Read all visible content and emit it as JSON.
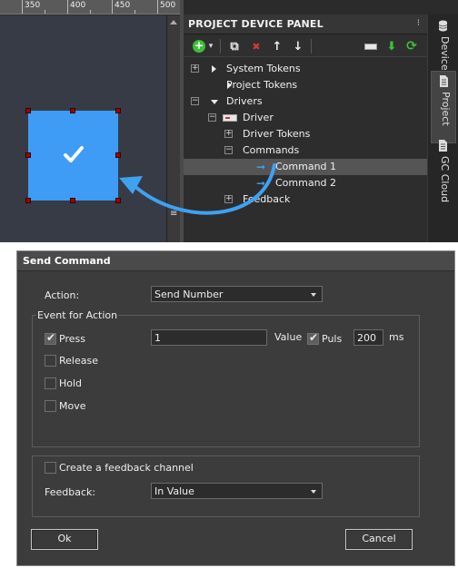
{
  "ruler": {
    "ticks": [
      "350",
      "400",
      "450",
      "500"
    ]
  },
  "widget": {
    "icon": "checkmark-icon",
    "fill": "#3e9cf6",
    "handle_color": "#a30000"
  },
  "panel": {
    "title": "PROJECT DEVICE PANEL",
    "pin_glyph": "⁝",
    "toolbar": {
      "add_glyph": "+",
      "dropdown_glyph": "▾",
      "copy_glyph": "⧉",
      "delete_glyph": "✖",
      "up_glyph": "↑",
      "down_glyph": "↓",
      "import_glyph": "⬇",
      "refresh_glyph": "⟳"
    },
    "tree": [
      {
        "label": "System Tokens"
      },
      {
        "label": "Project Tokens"
      },
      {
        "label": "Drivers"
      },
      {
        "label": "Driver"
      },
      {
        "label": "Driver Tokens"
      },
      {
        "label": "Commands"
      },
      {
        "label": "Command 1",
        "selected": true
      },
      {
        "label": "Command 2"
      },
      {
        "label": "Feedback"
      }
    ],
    "expander_plus": "+",
    "expander_minus": "−",
    "cmd_arrow": "➞"
  },
  "side_tabs": [
    "Device",
    "Project",
    "GC Cloud"
  ],
  "colors": {
    "accent": "#3ea2f2",
    "add_green": "#3cbf3c",
    "delete_red": "#d23a3a",
    "import_green": "#3cbf3c"
  },
  "dialog": {
    "title": "Send Command",
    "action_label": "Action:",
    "action_value": "Send Number",
    "event_group_label": "Event for Action",
    "events": [
      {
        "label": "Press",
        "checked": true
      },
      {
        "label": "Release",
        "checked": false
      },
      {
        "label": "Hold",
        "checked": false
      },
      {
        "label": "Move",
        "checked": false
      }
    ],
    "check_glyph": "✔",
    "value_input": "1",
    "value_label": "Value",
    "puls_label": "Puls",
    "puls_checked": true,
    "ms_input": "200",
    "ms_label": "ms",
    "feedback_channel_label": "Create a feedback channel",
    "feedback_label": "Feedback:",
    "feedback_value": "In Value",
    "ok_label": "Ok",
    "cancel_label": "Cancel"
  }
}
